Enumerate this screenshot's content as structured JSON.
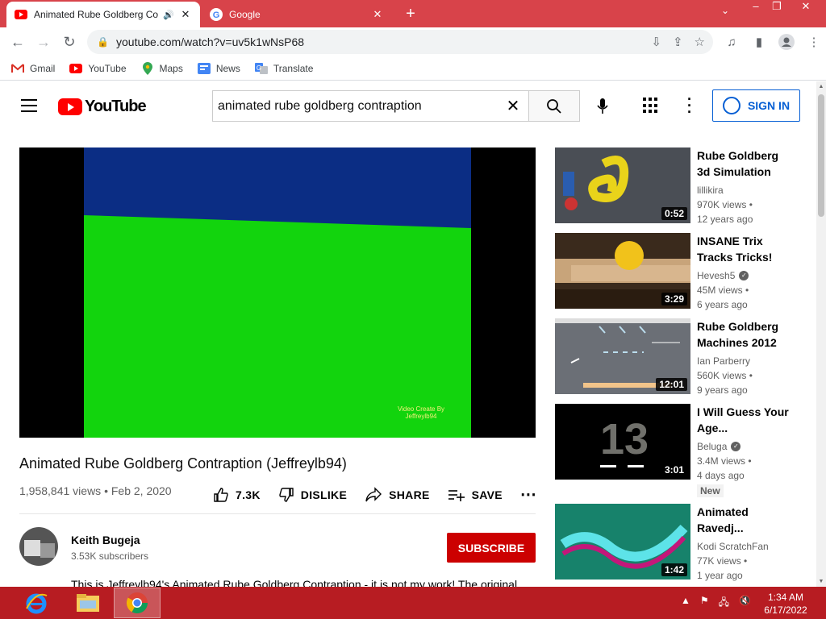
{
  "browser": {
    "tabs": [
      {
        "title": "Animated Rube Goldberg Co",
        "active": true,
        "favicon": "youtube-icon"
      },
      {
        "title": "Google",
        "active": false,
        "favicon": "google-icon"
      }
    ],
    "url": "youtube.com/watch?v=uv5k1wNsP68",
    "bookmarks": [
      {
        "label": "Gmail",
        "icon": "gmail-icon"
      },
      {
        "label": "YouTube",
        "icon": "youtube-icon"
      },
      {
        "label": "Maps",
        "icon": "maps-icon"
      },
      {
        "label": "News",
        "icon": "news-icon"
      },
      {
        "label": "Translate",
        "icon": "translate-icon"
      }
    ]
  },
  "youtube": {
    "logo_text": "YouTube",
    "search_query": "animated rube goldberg contraption",
    "signin_label": "SIGN IN",
    "video": {
      "watermark": "Video Create By\nJeffreylb94",
      "title": "Animated Rube Goldberg Contraption (Jeffreylb94)",
      "meta": "1,958,841 views • Feb 2, 2020",
      "likes": "7.3K",
      "dislike_label": "DISLIKE",
      "share_label": "SHARE",
      "save_label": "SAVE"
    },
    "channel": {
      "name": "Keith Bugeja",
      "subscribers": "3.53K subscribers",
      "subscribe_label": "SUBSCRIBE"
    },
    "description": "This is Jeffreylb94's Animated Rube Goldberg Contraption - it is not my work! The original",
    "recommendations": [
      {
        "title": "Rube Goldberg 3d Simulation",
        "channel": "lillikira",
        "verified": false,
        "views": "970K views •",
        "age": "12 years ago",
        "duration": "0:52",
        "badge": ""
      },
      {
        "title": "INSANE Trix Tracks Tricks!",
        "channel": "Hevesh5",
        "verified": true,
        "views": "45M views •",
        "age": "6 years ago",
        "duration": "3:29",
        "badge": ""
      },
      {
        "title": "Rube Goldberg Machines 2012",
        "channel": "Ian Parberry",
        "verified": false,
        "views": "560K views •",
        "age": "9 years ago",
        "duration": "12:01",
        "badge": ""
      },
      {
        "title": "I Will Guess Your Age...",
        "channel": "Beluga",
        "verified": true,
        "views": "3.4M views •",
        "age": "4 days ago",
        "duration": "3:01",
        "badge": "New"
      },
      {
        "title": "Animated Ravedj...",
        "channel": "Kodi ScratchFan",
        "verified": false,
        "views": "77K views •",
        "age": "1 year ago",
        "duration": "1:42",
        "badge": ""
      }
    ]
  },
  "taskbar": {
    "time": "1:34 AM",
    "date": "6/17/2022"
  },
  "colors": {
    "tabstrip": "#d8434a",
    "taskbar": "#b71c22",
    "youtube_red": "#ff0000",
    "subscribe": "#cc0000",
    "signin_blue": "#065fd4"
  }
}
